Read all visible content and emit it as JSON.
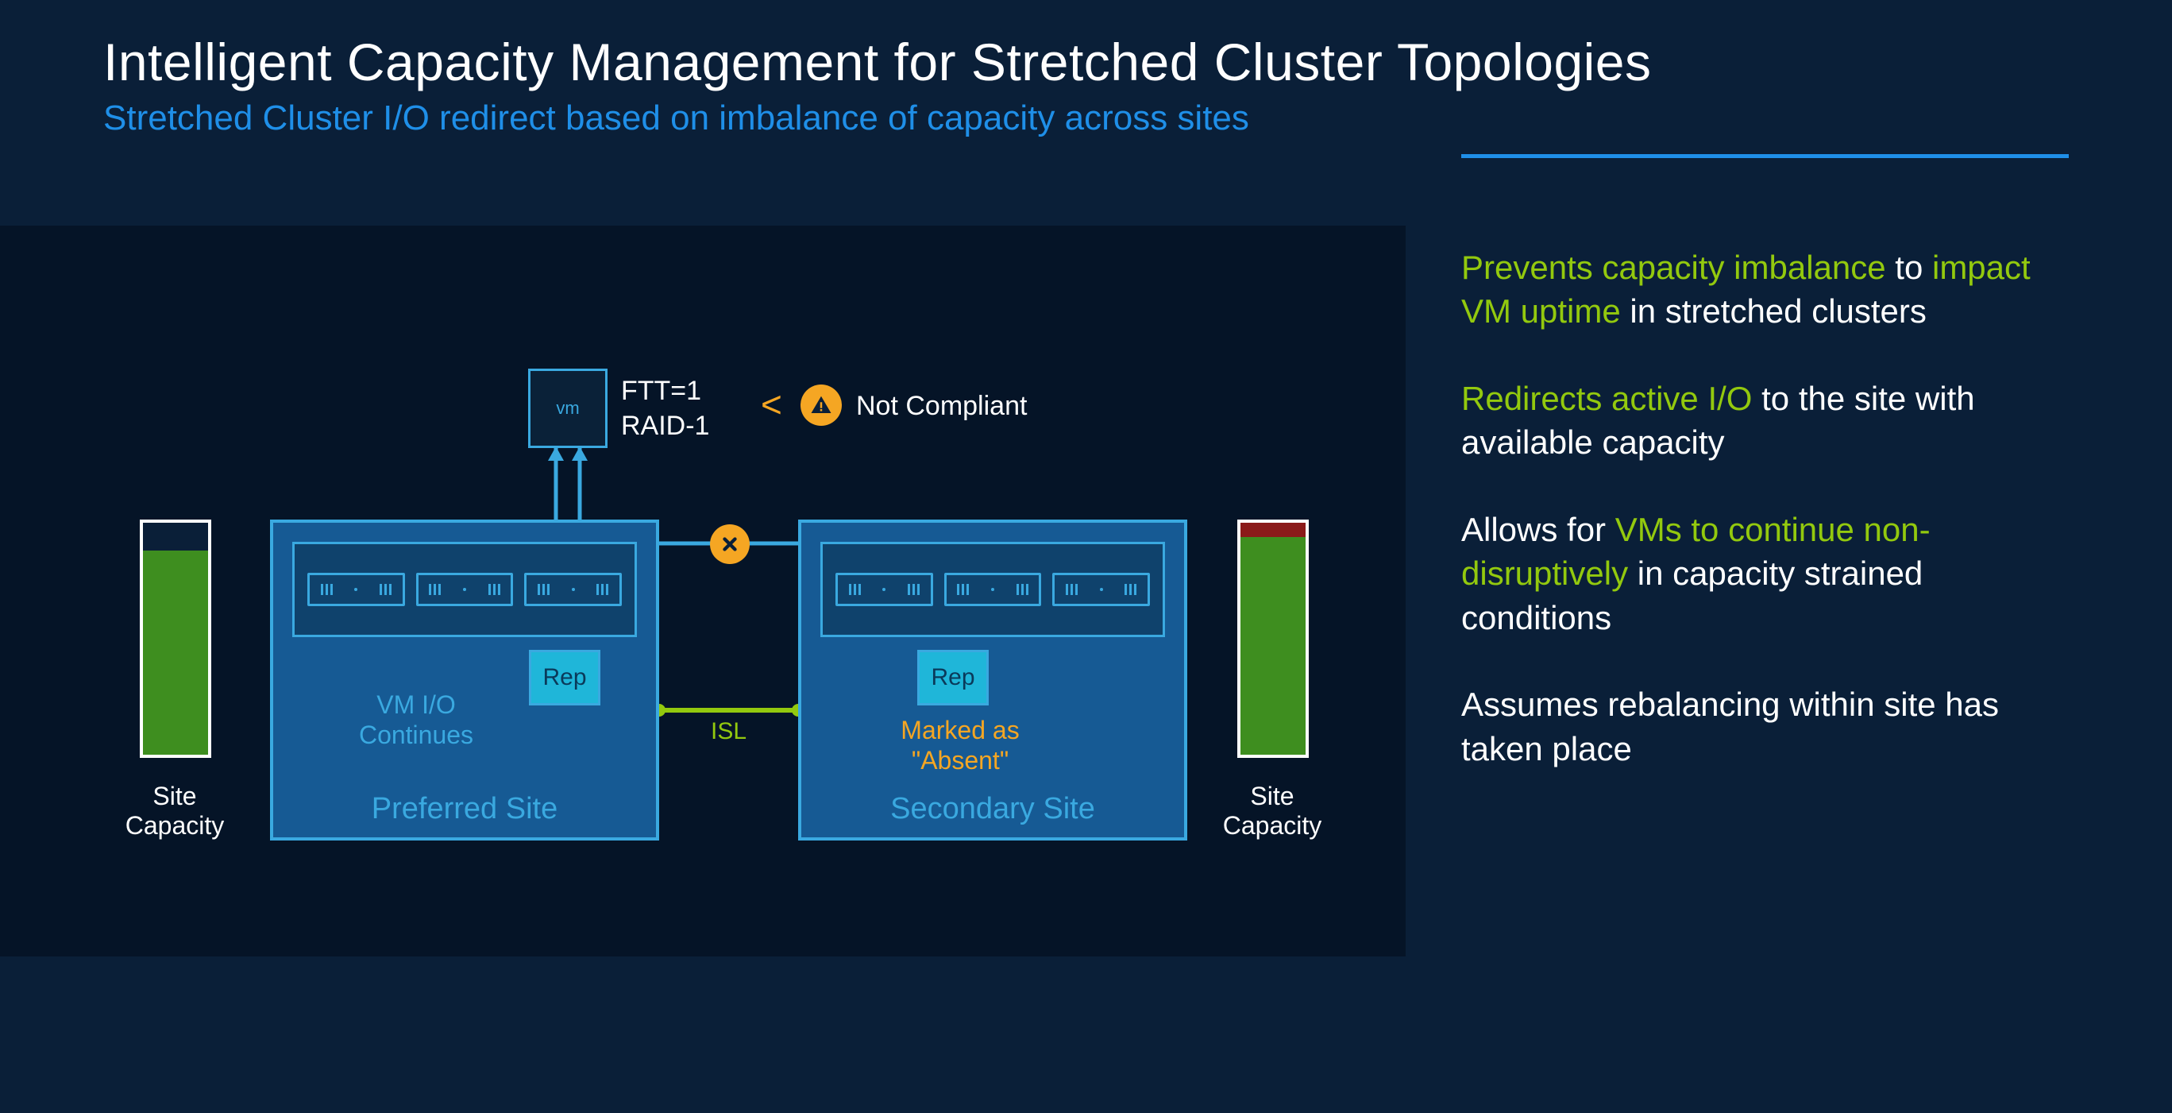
{
  "header": {
    "title": "Intelligent Capacity Management for Stretched Cluster Topologies",
    "subtitle": "Stretched Cluster I/O redirect based on imbalance of capacity across sites"
  },
  "diagram": {
    "vm_label": "vm",
    "ftt_line1": "FTT=1",
    "ftt_line2": "RAID-1",
    "lt_symbol": "<",
    "not_compliant": "Not Compliant",
    "preferred": {
      "name": "Preferred Site",
      "rep": "Rep",
      "status_line1": "VM I/O",
      "status_line2": "Continues"
    },
    "secondary": {
      "name": "Secondary Site",
      "rep": "Rep",
      "status_line1": "Marked as",
      "status_line2": "\"Absent\""
    },
    "isl": "ISL",
    "capacity_label": "Site Capacity",
    "left_fill_pct": 88,
    "right_fill_pct": 94,
    "right_red_pct": 6
  },
  "bullets": {
    "b1_a": "Prevents capacity imbalance",
    "b1_b": " to ",
    "b1_c": "impact VM uptime",
    "b1_d": " in stretched clusters",
    "b2_a": "Redirects active I/O",
    "b2_b": " to the site with available capacity",
    "b3_a": "Allows for ",
    "b3_b": "VMs to continue non-disruptively",
    "b3_c": " in capacity strained conditions",
    "b4": "Assumes rebalancing within site has taken place"
  }
}
